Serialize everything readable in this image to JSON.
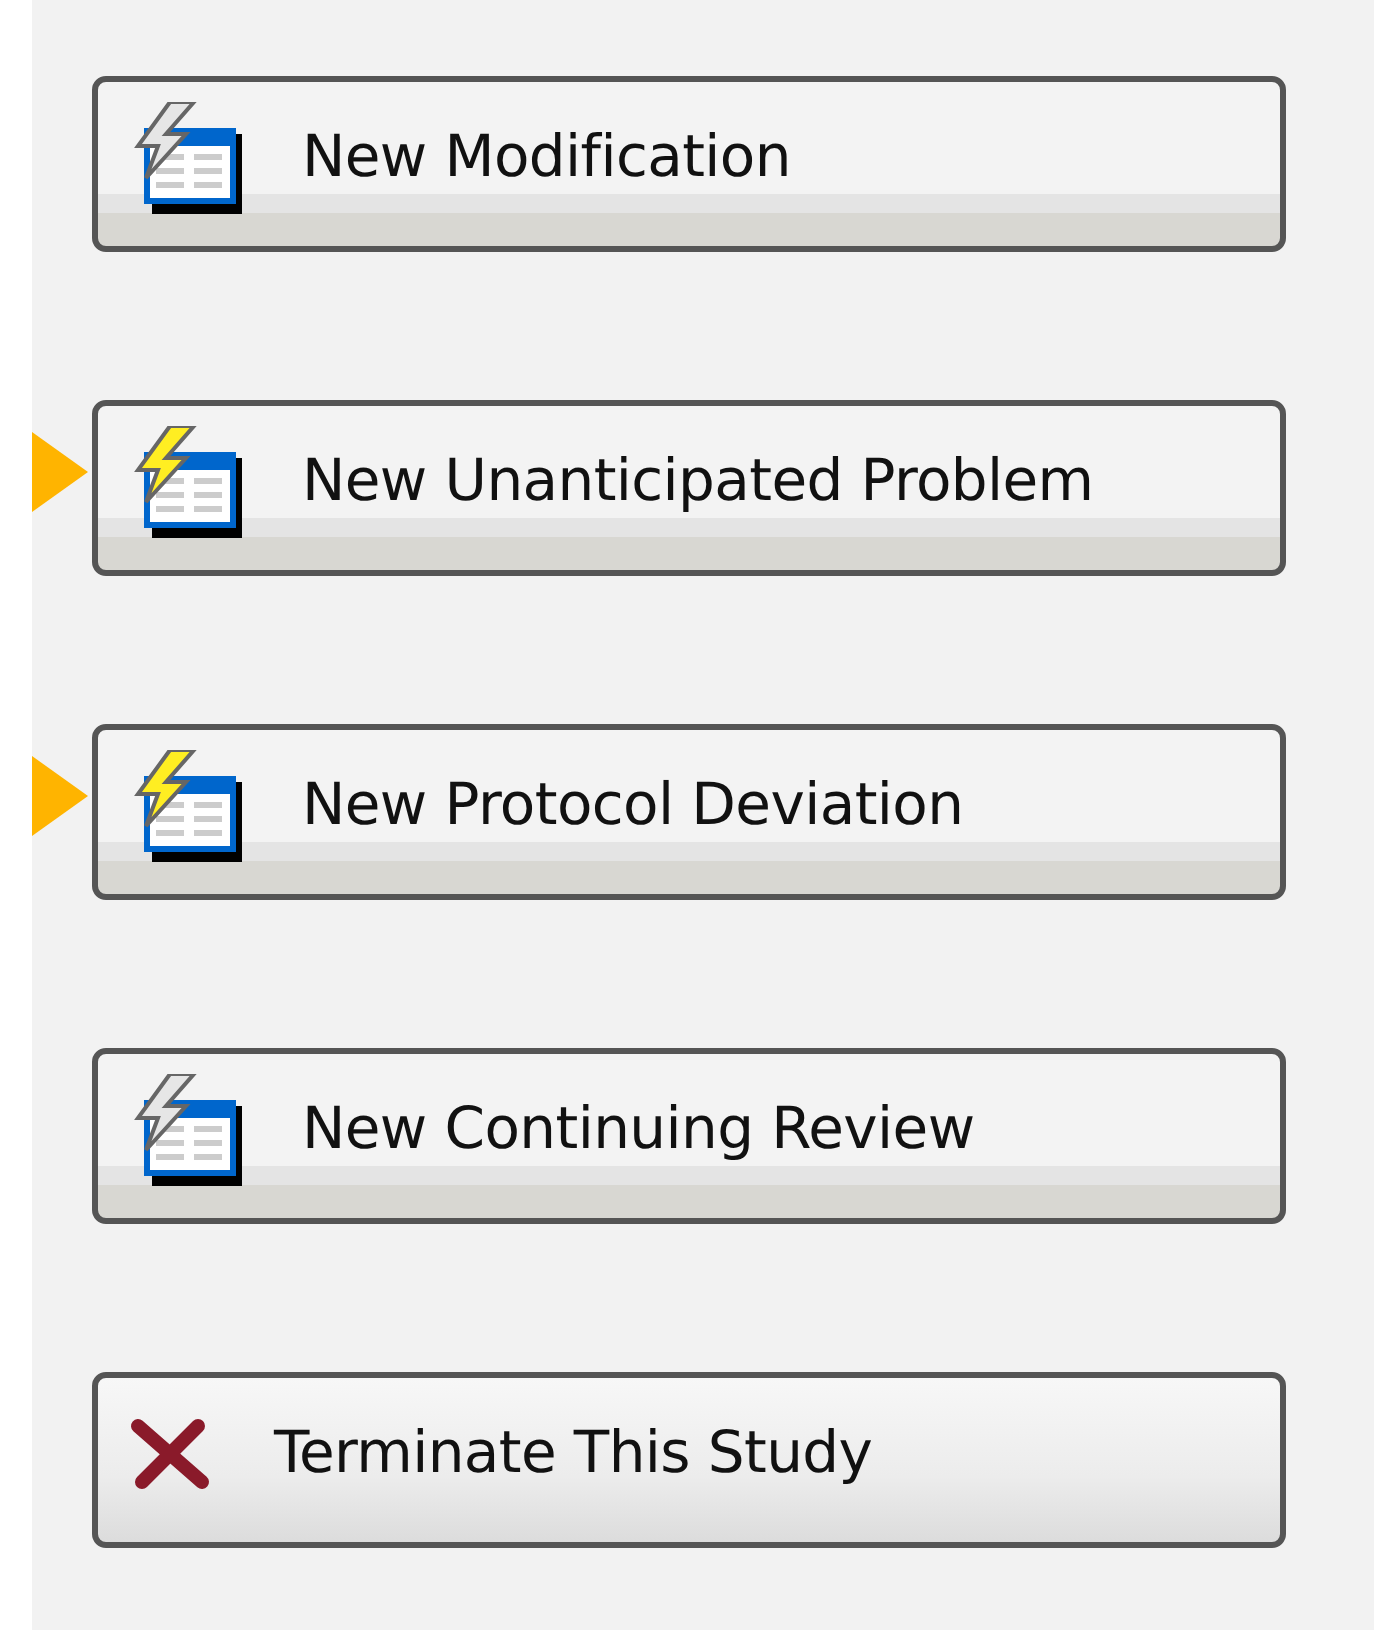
{
  "buttons": [
    {
      "label": "New Modification",
      "kind": "form",
      "highlighted": false
    },
    {
      "label": "New Unanticipated Problem",
      "kind": "form",
      "highlighted": true
    },
    {
      "label": "New Protocol Deviation",
      "kind": "form",
      "highlighted": true
    },
    {
      "label": "New Continuing Review",
      "kind": "form",
      "highlighted": false
    },
    {
      "label": "Terminate This Study",
      "kind": "terminate",
      "highlighted": false
    }
  ]
}
